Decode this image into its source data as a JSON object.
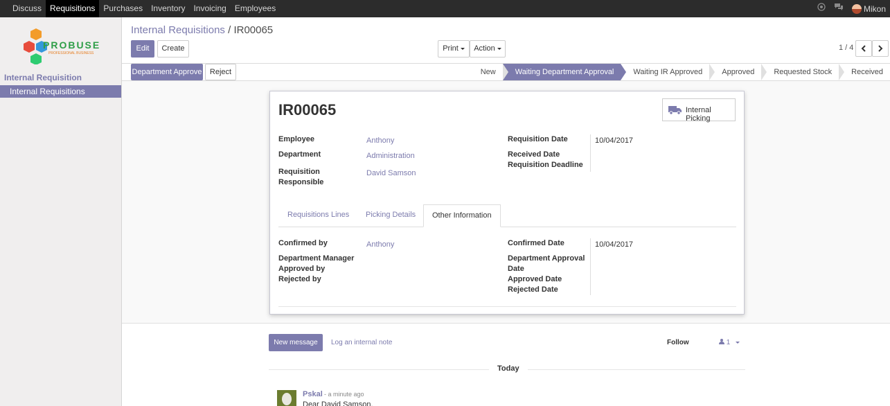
{
  "topbar": {
    "menu": [
      "Discuss",
      "Requisitions",
      "Purchases",
      "Inventory",
      "Invoicing",
      "Employees"
    ],
    "active_index": 1,
    "user": "Mikon"
  },
  "sidebar": {
    "brand": "PROBUSE",
    "brand_sub": "PROFESSIONAL BUSINESS",
    "section": "Internal Requisition",
    "item": "Internal Requisitions"
  },
  "breadcrumb": {
    "parent": "Internal Requisitions",
    "separator": "/",
    "current": "IR00065"
  },
  "buttons": {
    "edit": "Edit",
    "create": "Create",
    "print": "Print",
    "action": "Action",
    "department_approve": "Department Approve",
    "reject": "Reject"
  },
  "pager": {
    "text": "1 / 4"
  },
  "statusbar": {
    "steps": [
      "New",
      "Waiting Department Approval",
      "Waiting IR Approved",
      "Approved",
      "Requested Stock",
      "Received"
    ],
    "active_index": 1
  },
  "form": {
    "title": "IR00065",
    "smart_button": "Internal Picking",
    "employee_label": "Employee",
    "employee": "Anthony",
    "department_label": "Department",
    "department": "Administration",
    "responsible_label_1": "Requisition",
    "responsible_label_2": "Responsible",
    "responsible": "David Samson",
    "req_date_label": "Requisition Date",
    "req_date": "10/04/2017",
    "received_date_label": "Received Date",
    "deadline_label": "Requisition Deadline",
    "tabs": [
      "Requisitions Lines",
      "Picking Details",
      "Other Information"
    ],
    "active_tab": 2,
    "confirmed_by_label": "Confirmed by",
    "confirmed_by": "Anthony",
    "dept_manager_label_1": "Department Manager",
    "dept_manager_label_2": "Approved by",
    "rejected_by_label": "Rejected by",
    "confirmed_date_label": "Confirmed Date",
    "confirmed_date": "10/04/2017",
    "dept_approval_label_1": "Department Approval",
    "dept_approval_label_2": "Date",
    "approved_date_label": "Approved Date",
    "rejected_date_label": "Rejected Date"
  },
  "chatter": {
    "new_message": "New message",
    "log_note": "Log an internal note",
    "follow": "Follow",
    "followers": "1",
    "today": "Today",
    "message": {
      "author": "Pskal",
      "time": "- a minute ago",
      "body": "Dear David Samson,"
    }
  },
  "colors": {
    "accent": "#7c7bad",
    "topbar": "#2c2c2c"
  }
}
